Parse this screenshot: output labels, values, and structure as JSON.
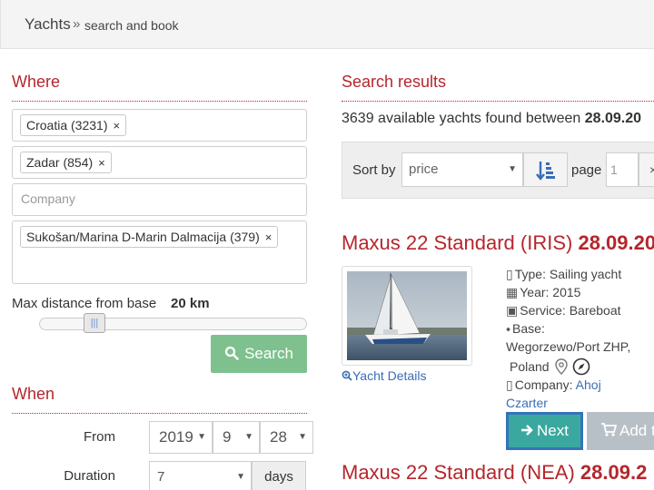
{
  "breadcrumb": {
    "main": "Yachts",
    "separator": "»",
    "sub": "search and book"
  },
  "where": {
    "title": "Where",
    "country_tag": "Croatia (3231)",
    "region_tag": "Zadar (854)",
    "company_placeholder": "Company",
    "marina_tag": "Sukošan/Marina D-Marin Dalmacija (379)",
    "remove_symbol": "×",
    "distance_label": "Max distance from base",
    "distance_value": "20 km",
    "search_label": "Search"
  },
  "when": {
    "title": "When",
    "from_label": "From",
    "year": "2019",
    "month": "9",
    "day": "28",
    "duration_label": "Duration",
    "duration_value": "7",
    "duration_unit": "days"
  },
  "results": {
    "title": "Search results",
    "found_text": "3639 available yachts found between",
    "found_date": "28.09.20",
    "sort_label": "Sort by",
    "sort_value": "price",
    "page_label": "page",
    "page_value": "1",
    "page_clear": "×",
    "items": [
      {
        "name": "Maxus 22 Standard (IRIS)",
        "date": "28.09.20",
        "type": "Type: Sailing yacht",
        "year": "Year: 2015",
        "service": "Service: Bareboat",
        "base_label": "Base:",
        "base_line1": "Wegorzewo/Port ZHP,",
        "base_line2": "Poland",
        "company_label": "Company:",
        "company_name_1": "Ahoj",
        "company_name_2": "Czarter",
        "details_label": "Yacht Details",
        "next_label": "Next",
        "add_label": "Add t"
      },
      {
        "name": "Maxus 22 Standard (NEA)",
        "date": "28.09.2"
      }
    ]
  },
  "colors": {
    "accent": "#b5262c",
    "search_button": "#7ec18e",
    "next_button": "#3aa89f",
    "link": "#3a6db5"
  }
}
